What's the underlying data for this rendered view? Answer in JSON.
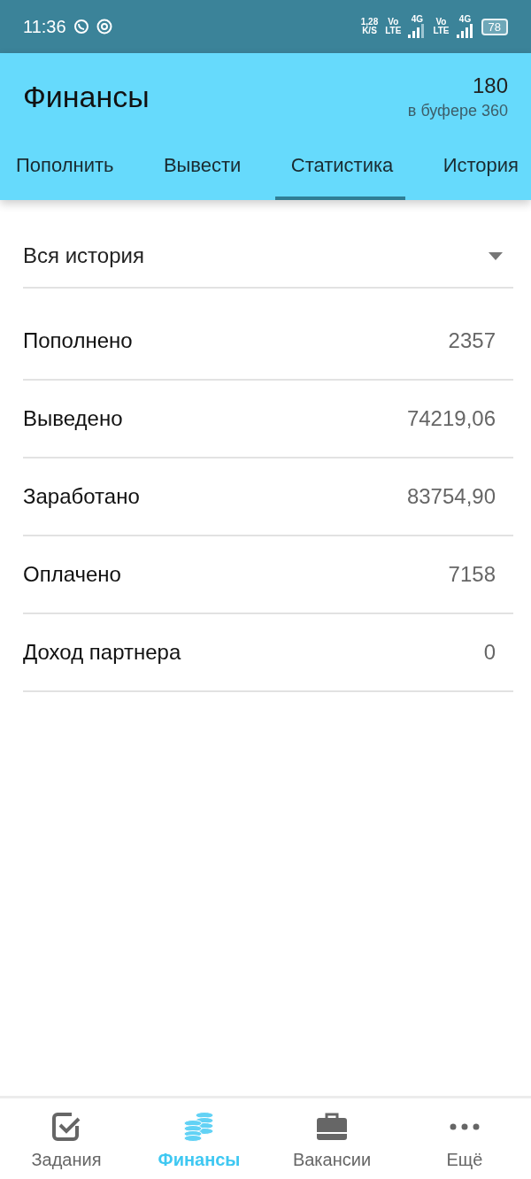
{
  "status_bar": {
    "time": "11:36",
    "speed": "1,28",
    "speed_unit": "K/S",
    "sim1_volte": [
      "Vo",
      "LTE"
    ],
    "sim1_net": "4G",
    "sim2_volte": [
      "Vo",
      "LTE"
    ],
    "sim2_net": "4G",
    "battery": "78"
  },
  "header": {
    "title": "Финансы",
    "balance": "180",
    "buffer": "в буфере 360"
  },
  "tabs": [
    {
      "label": "Пополнить",
      "selected": false
    },
    {
      "label": "Вывести",
      "selected": false
    },
    {
      "label": "Статистика",
      "selected": true
    },
    {
      "label": "История",
      "selected": false
    }
  ],
  "period": {
    "value": "Вся история"
  },
  "stats": [
    {
      "label": "Пополнено",
      "value": "2357"
    },
    {
      "label": "Выведено",
      "value": "74219,06"
    },
    {
      "label": "Заработано",
      "value": "83754,90"
    },
    {
      "label": "Оплачено",
      "value": "7158"
    },
    {
      "label": "Доход партнера",
      "value": "0"
    }
  ],
  "bottom_nav": [
    {
      "kind": "tasks",
      "label": "Задания",
      "selected": false
    },
    {
      "kind": "finance",
      "label": "Финансы",
      "selected": true
    },
    {
      "kind": "jobs",
      "label": "Вакансии",
      "selected": false
    },
    {
      "kind": "more",
      "label": "Ещё",
      "selected": false
    }
  ]
}
